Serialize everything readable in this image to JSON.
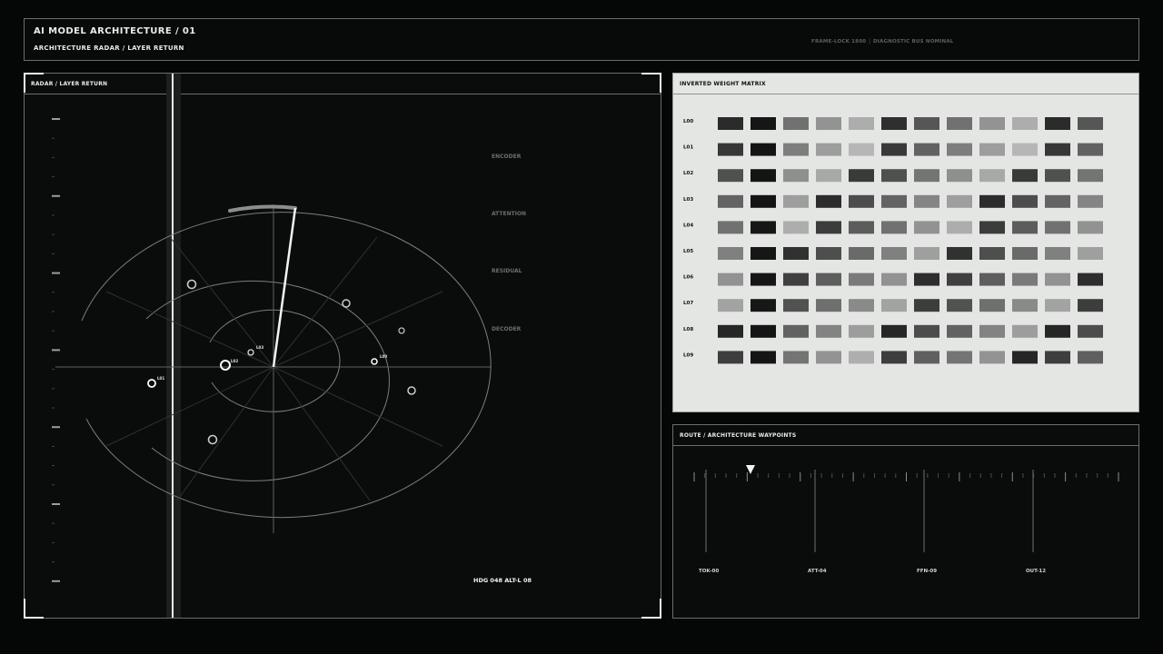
{
  "header": {
    "title": "AI MODEL ARCHITECTURE / 01",
    "subtitle": "ARCHITECTURE RADAR / LAYER RETURN",
    "status": "FRAME-LOCK 1800 │ DIAGNOSTIC BUS NOMINAL"
  },
  "radar": {
    "title": "RADAR / LAYER RETURN",
    "stages": [
      "ENCODER",
      "ATTENTION",
      "RESIDUAL",
      "DECODER"
    ],
    "readout": "HDG 048  ALT-L 08",
    "blip_labels": [
      "L03",
      "L02",
      "L01",
      "L00"
    ]
  },
  "matrix": {
    "title": "INVERTED WEIGHT MATRIX",
    "rows": [
      "L00",
      "L01",
      "L02",
      "L03",
      "L04",
      "L05",
      "L06",
      "L07",
      "L08",
      "L09"
    ],
    "cells": [
      [
        "#2b2b2b",
        "#161616",
        "#717171",
        "#939393",
        "#adadad",
        "#2f2f2f",
        "#565656",
        "#717171",
        "#939393",
        "#adadad",
        "#2b2b2b",
        "#565656"
      ],
      [
        "#373737",
        "#141414",
        "#7e7e7e",
        "#9d9d9d",
        "#b6b6b6",
        "#393939",
        "#626262",
        "#7e7e7e",
        "#9d9d9d",
        "#b6b6b6",
        "#373737",
        "#626262"
      ],
      [
        "#505050",
        "#141414",
        "#8f8f8f",
        "#a8a8a8",
        "#3a3a3a",
        "#505050",
        "#747474",
        "#8f8f8f",
        "#a8a8a8",
        "#3a3a3a",
        "#505050",
        "#747474"
      ],
      [
        "#636363",
        "#141414",
        "#9e9e9e",
        "#2c2c2c",
        "#4d4d4d",
        "#636363",
        "#858585",
        "#9e9e9e",
        "#2c2c2c",
        "#4d4d4d",
        "#636363",
        "#858585"
      ],
      [
        "#717171",
        "#161616",
        "#adadad",
        "#3c3c3c",
        "#5c5c5c",
        "#717171",
        "#929292",
        "#adadad",
        "#3c3c3c",
        "#5c5c5c",
        "#717171",
        "#929292"
      ],
      [
        "#808080",
        "#161616",
        "#313131",
        "#4e4e4e",
        "#6a6a6a",
        "#808080",
        "#9f9f9f",
        "#313131",
        "#4e4e4e",
        "#6a6a6a",
        "#808080",
        "#9f9f9f"
      ],
      [
        "#929292",
        "#161616",
        "#404040",
        "#5e5e5e",
        "#7a7a7a",
        "#929292",
        "#2e2e2e",
        "#404040",
        "#5e5e5e",
        "#7a7a7a",
        "#929292",
        "#2e2e2e"
      ],
      [
        "#a3a3a3",
        "#171717",
        "#525252",
        "#6f6f6f",
        "#8a8a8a",
        "#a3a3a3",
        "#3d3d3d",
        "#525252",
        "#6f6f6f",
        "#8a8a8a",
        "#a3a3a3",
        "#3d3d3d"
      ],
      [
        "#262626",
        "#151515",
        "#626262",
        "#838383",
        "#9d9d9d",
        "#262626",
        "#4c4c4c",
        "#626262",
        "#838383",
        "#9d9d9d",
        "#262626",
        "#4c4c4c"
      ],
      [
        "#3e3e3e",
        "#151515",
        "#747474",
        "#939393",
        "#aeaeae",
        "#3e3e3e",
        "#5f5f5f",
        "#747474",
        "#939393",
        "#262626",
        "#3e3e3e",
        "#5f5f5f"
      ]
    ]
  },
  "route": {
    "title": "ROUTE / ARCHITECTURE WAYPOINTS",
    "waypoints": [
      "TOK-00",
      "ATT-04",
      "FFN-09",
      "OUT-12"
    ]
  },
  "colors": {
    "background": "#050606",
    "panel": "#0a0c0c",
    "matrix_bg": "#e4e6e4",
    "accent": "#f2f4f3"
  }
}
